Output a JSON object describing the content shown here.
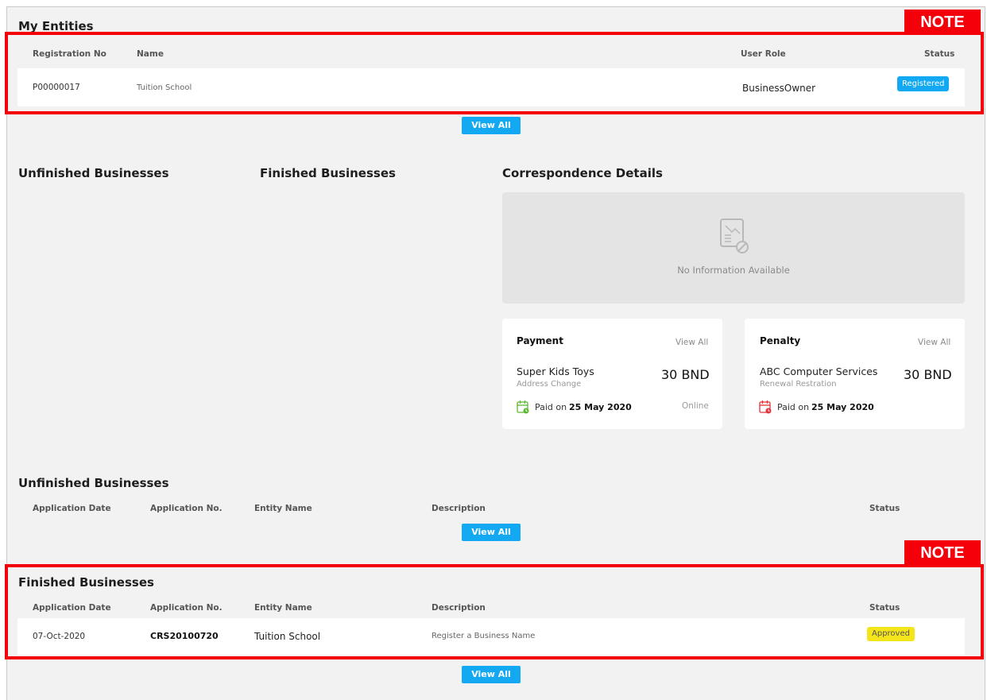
{
  "my_entities": {
    "title": "My Entities",
    "columns": {
      "registration_no": "Registration No",
      "name": "Name",
      "user_role": "User Role",
      "status": "Status"
    },
    "rows": [
      {
        "registration_no": "P00000017",
        "name": "Tuition School",
        "user_role": "BusinessOwner",
        "status": "Registered"
      }
    ],
    "view_all": "View All"
  },
  "sections": {
    "unfinished_title": "Unfinished Businesses",
    "finished_title": "Finished Businesses",
    "correspondence_title": "Correspondence Details",
    "no_info": "No Information Available"
  },
  "payment_card": {
    "title": "Payment",
    "view_all": "View All",
    "name": "Super Kids Toys",
    "sub": "Address Change",
    "amount": "30 BND",
    "paid_on_label": "Paid on",
    "paid_date": "25 May 2020",
    "method": "Online",
    "icon_color": "#5cb82e"
  },
  "penalty_card": {
    "title": "Penalty",
    "view_all": "View All",
    "name": "ABC Computer Services",
    "sub": "Renewal Restration",
    "amount": "30 BND",
    "paid_on_label": "Paid on",
    "paid_date": "25 May 2020",
    "icon_color": "#e2323a"
  },
  "unfinished_businesses": {
    "title": "Unfinished Businesses",
    "columns": {
      "application_date": "Application Date",
      "application_no": "Application No.",
      "entity_name": "Entity Name",
      "description": "Description",
      "status": "Status"
    },
    "view_all": "View All"
  },
  "finished_businesses": {
    "title": "Finished Businesses",
    "columns": {
      "application_date": "Application Date",
      "application_no": "Application No.",
      "entity_name": "Entity Name",
      "description": "Description",
      "status": "Status"
    },
    "rows": [
      {
        "application_date": "07-Oct-2020",
        "application_no": "CRS20100720",
        "entity_name": "Tuition School",
        "description": "Register a Business Name",
        "status": "Approved"
      }
    ],
    "view_all": "View All"
  },
  "notes": {
    "label": "NOTE"
  },
  "colors": {
    "accent": "#12a9f2",
    "note_red": "#f4000b",
    "approved": "#f4e41a",
    "background": "#f2f2f3"
  }
}
